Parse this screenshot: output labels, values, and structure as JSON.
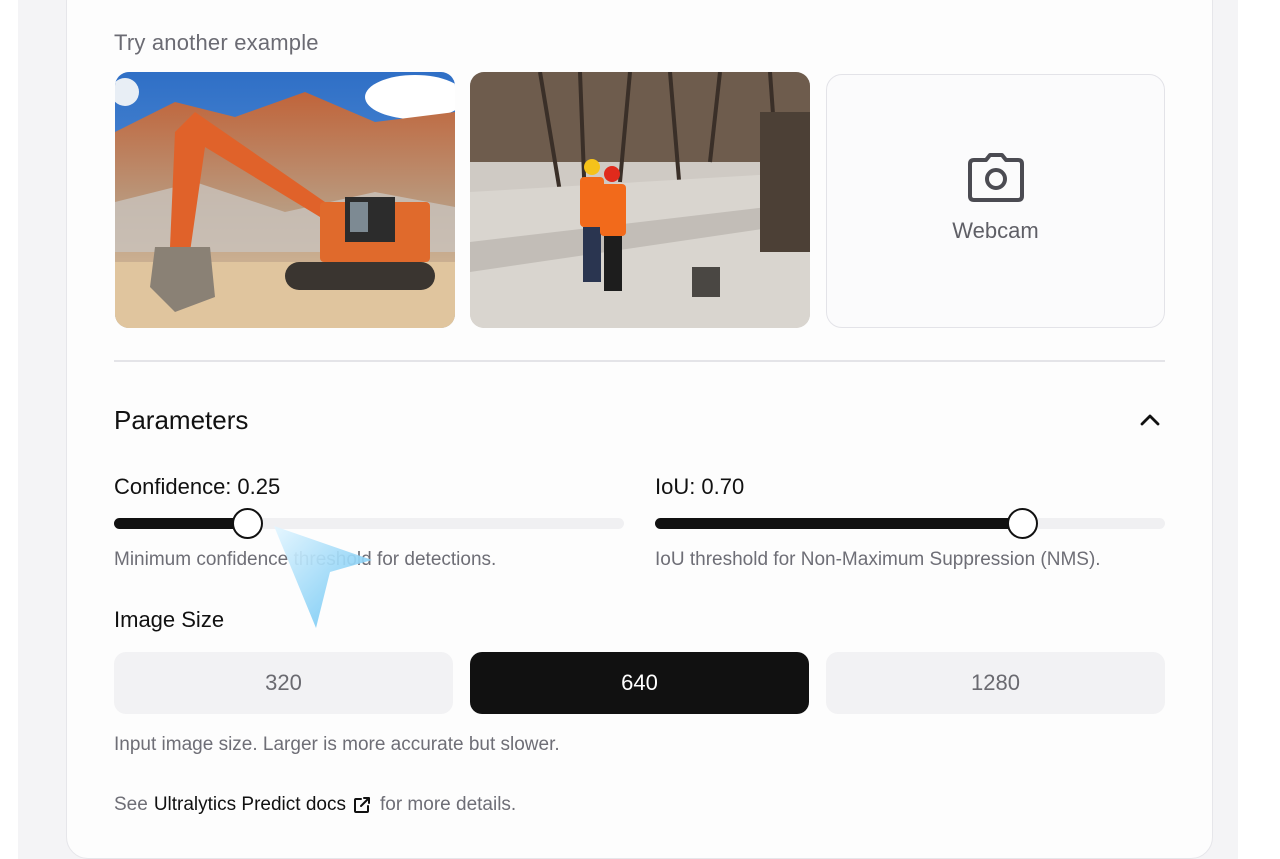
{
  "examples": {
    "heading": "Try another example",
    "webcam_label": "Webcam",
    "webcam_icon": "camera-icon"
  },
  "parameters": {
    "title": "Parameters",
    "collapse_icon": "chevron-up-icon",
    "confidence": {
      "label": "Confidence:",
      "value_text": "0.25",
      "fill_fraction": 0.26,
      "helper": "Minimum confidence threshold for detections."
    },
    "iou": {
      "label": "IoU:",
      "value_text": "0.70",
      "fill_fraction": 0.72,
      "helper": "IoU threshold for Non-Maximum Suppression (NMS)."
    },
    "image_size": {
      "title": "Image Size",
      "options": [
        "320",
        "640",
        "1280"
      ],
      "selected": "640",
      "helper": "Input image size. Larger is more accurate but slower."
    }
  },
  "footer": {
    "prefix": "See",
    "link_text": "Ultralytics Predict docs",
    "link_icon": "external-link-icon",
    "suffix": "for more details."
  },
  "colors": {
    "accent": "#111111",
    "muted_text": "#6e6e76",
    "track": "#f0f0f2"
  }
}
